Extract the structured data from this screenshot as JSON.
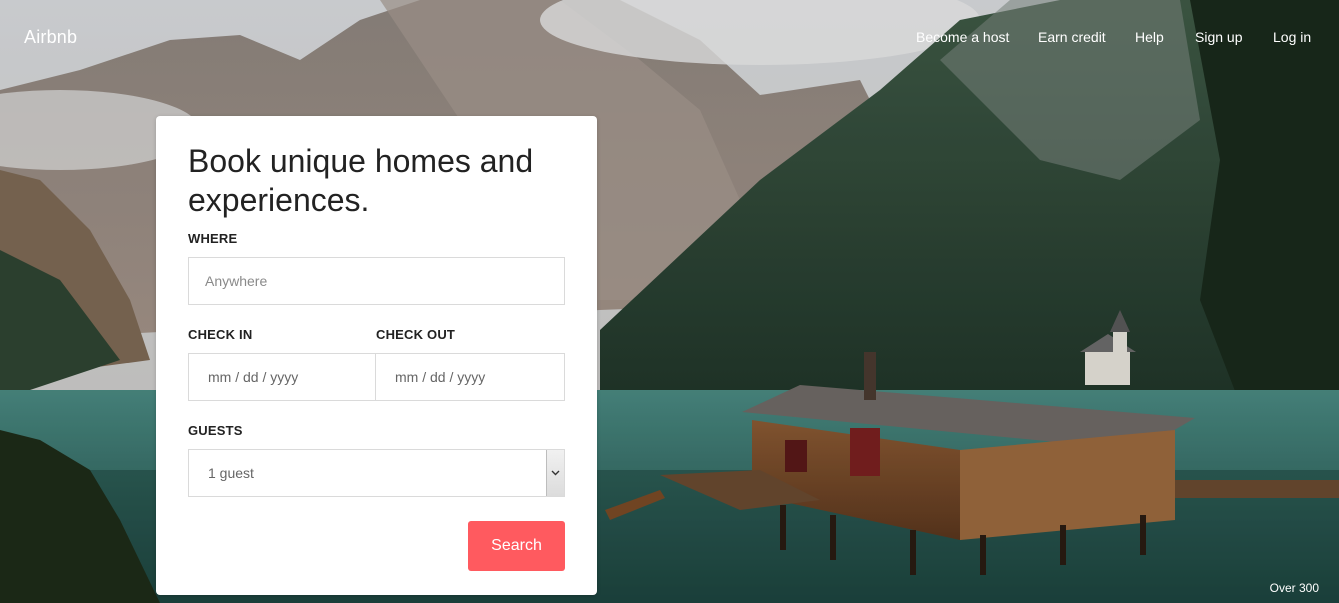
{
  "brand": "Airbnb",
  "nav": [
    {
      "label": "Become a host"
    },
    {
      "label": "Earn credit"
    },
    {
      "label": "Help"
    },
    {
      "label": "Sign up"
    },
    {
      "label": "Log in"
    }
  ],
  "card": {
    "headline": "Book unique homes and experiences.",
    "where": {
      "label": "WHERE",
      "placeholder": "Anywhere",
      "value": ""
    },
    "check_in": {
      "label": "CHECK IN",
      "value": "mm / dd / yyyy"
    },
    "check_out": {
      "label": "CHECK OUT",
      "value": "mm / dd / yyyy"
    },
    "guests": {
      "label": "GUESTS",
      "selected": "1 guest"
    },
    "search_label": "Search"
  },
  "corner_text": "Over 300",
  "colors": {
    "accent": "#ff5a5f",
    "card_bg": "#ffffff",
    "text": "#222222"
  },
  "icons": {
    "select_arrow": "chevron-down-icon"
  }
}
